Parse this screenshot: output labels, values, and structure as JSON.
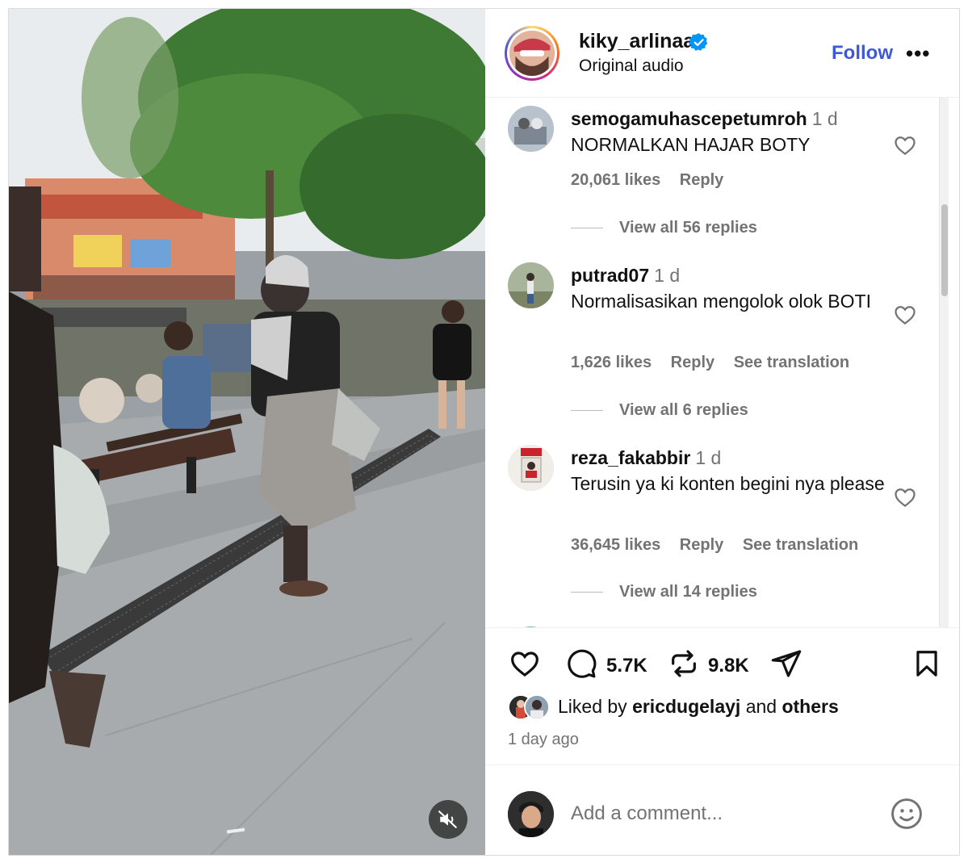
{
  "post": {
    "owner": {
      "username": "kiky_arlinaa",
      "verified": true,
      "audio": "Original audio"
    },
    "follow_label": "Follow",
    "more_label": "•••",
    "media": {
      "muted": true,
      "mute_icon": "speaker-muted-icon"
    }
  },
  "comments": [
    {
      "username": "semogamuhascepetumroh",
      "time": "1 d",
      "text": "NORMALKAN HAJAR BOTY",
      "likes": "20,061 likes",
      "reply_label": "Reply",
      "translation_label": "",
      "view_replies": "View all 56 replies"
    },
    {
      "username": "putrad07",
      "time": "1 d",
      "text": "Normalisasikan mengolok olok BOTI",
      "likes": "1,626 likes",
      "reply_label": "Reply",
      "translation_label": "See translation",
      "view_replies": "View all 6 replies"
    },
    {
      "username": "reza_fakabbir",
      "time": "1 d",
      "text": "Terusin ya ki konten begini nya please",
      "likes": "36,645 likes",
      "reply_label": "Reply",
      "translation_label": "See translation",
      "view_replies": "View all 14 replies"
    }
  ],
  "actions": {
    "comment_count": "5.7K",
    "repost_count": "9.8K",
    "icons": [
      "heart-icon",
      "comment-icon",
      "repost-icon",
      "share-icon",
      "bookmark-icon"
    ]
  },
  "likes_summary": {
    "prefix": "Liked by",
    "user": "ericdugelayj",
    "connector": "and",
    "others": "others"
  },
  "time_ago": "1 day ago",
  "add_comment": {
    "placeholder": "Add a comment..."
  },
  "colors": {
    "accent": "#3d59d9",
    "verified": "#0095f6",
    "muted_text": "#737373",
    "border": "#dbdbdb"
  }
}
